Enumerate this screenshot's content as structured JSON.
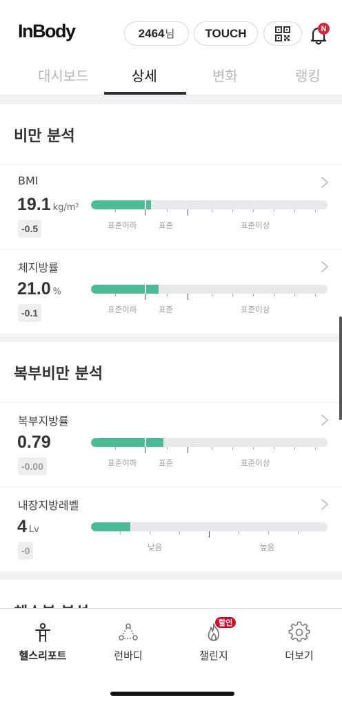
{
  "app": {
    "logo": "InBody"
  },
  "header": {
    "points_value": "2464",
    "points_unit": "님",
    "touch_label": "TOUCH",
    "qr_icon": "qr-code-icon",
    "bell_icon": "bell-icon",
    "notification_badge": "N"
  },
  "tabs": [
    {
      "label": "대시보드",
      "active": false
    },
    {
      "label": "상세",
      "active": true
    },
    {
      "label": "변화",
      "active": false
    },
    {
      "label": "랭킹",
      "active": false
    }
  ],
  "sections": [
    {
      "title": "비만 분석",
      "metrics": [
        {
          "name": "BMI",
          "value": "19.1",
          "unit": "kg/m²",
          "delta": "-0.5",
          "labels": [
            "표준이하",
            "표준",
            "표준이상"
          ],
          "fill": 0.255
        },
        {
          "name": "체지방률",
          "value": "21.0",
          "unit": "%",
          "delta": "-0.1",
          "labels": [
            "표준이하",
            "표준",
            "표준이상"
          ],
          "fill": 0.285
        }
      ]
    },
    {
      "title": "복부비만 분석",
      "metrics": [
        {
          "name": "복부지방률",
          "value": "0.79",
          "unit": "",
          "delta": "-0.00",
          "labels": [
            "표준이하",
            "표준",
            "표준이상"
          ],
          "fill": 0.305
        },
        {
          "name": "내장지방레벨",
          "value": "4",
          "unit": "Lv",
          "delta": "-0",
          "labels": [
            "낮음",
            "높음"
          ],
          "fill": 0.165
        }
      ]
    },
    {
      "title": "체수분 분석"
    }
  ],
  "bottom_nav": [
    {
      "label": "헬스리포트",
      "icon": "health-report-icon",
      "active": true
    },
    {
      "label": "런바디",
      "icon": "runbody-icon",
      "active": false
    },
    {
      "label": "챌린지",
      "icon": "challenge-flame-icon",
      "active": false,
      "badge": "할인"
    },
    {
      "label": "더보기",
      "icon": "settings-gear-icon",
      "active": false
    }
  ],
  "colors": {
    "accent": "#4cbc94",
    "track": "#e8e9ed",
    "badge": "#d7263d"
  }
}
